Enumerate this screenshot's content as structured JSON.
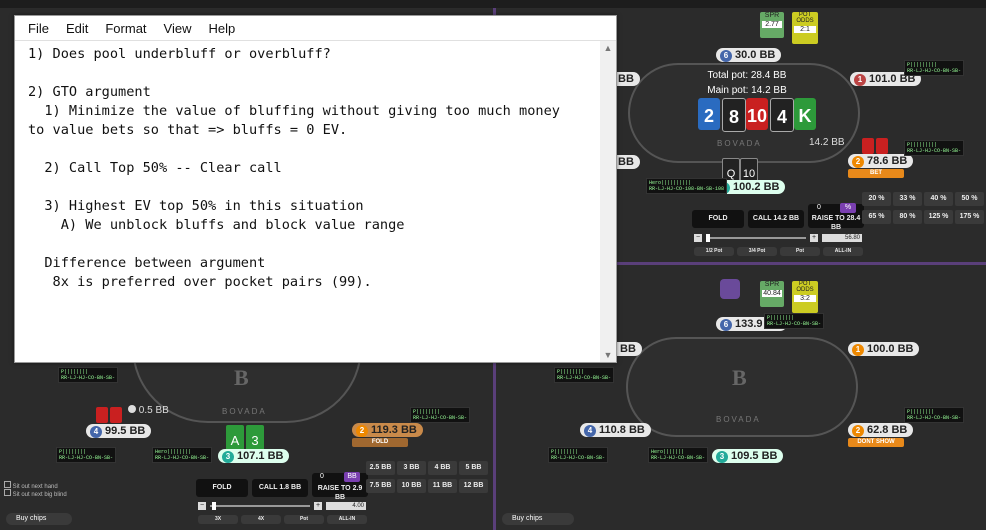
{
  "notepad": {
    "menu": [
      "File",
      "Edit",
      "Format",
      "View",
      "Help"
    ],
    "lines": [
      "1) Does pool underbluff or overbluff?",
      "",
      "2) GTO argument",
      "  1) Minimize the value of bluffing without giving too much money",
      "to value bets so that => bluffs = 0 EV.",
      "",
      "  2) Call Top 50% -- Clear call",
      "",
      "  3) Highest EV top 50% in this situation",
      "    A) We unblock bluffs and block value range",
      "",
      "  Difference between argument",
      "   8x is preferred over pocket pairs (99)."
    ],
    "scroll_up": "▲",
    "scroll_down": "▼"
  },
  "table_top_right": {
    "spr_label": "SPR",
    "spr_value": "2.77",
    "pot_odds_label": "POT ODDS",
    "pot_odds_value": "2:1",
    "total_pot": "Total pot: 28.4 BB",
    "main_pot": "Main pot: 14.2 BB",
    "board": [
      {
        "rank": "2",
        "text": "2",
        "color": "#2a6bc0"
      },
      {
        "rank": "8",
        "text": "8",
        "color": "#222222"
      },
      {
        "rank": "10",
        "text": "10",
        "color": "#c92020"
      },
      {
        "rank": "4",
        "text": "4",
        "color": "#222222"
      },
      {
        "rank": "K",
        "text": "K",
        "color": "#2d9a3a"
      }
    ],
    "brand": "BOVADA",
    "seats": {
      "top": "30.0 BB",
      "left": "BB",
      "right": "101.0 BB",
      "villain": "78.6 BB",
      "villain_action": "BET",
      "villain_bet": "14.2 BB",
      "hero": "100.2 BB",
      "hero_cards": [
        "Q",
        "10"
      ],
      "left2": "BB"
    },
    "actions": {
      "fold": "FOLD",
      "call": "CALL 14.2 BB",
      "raise": "RAISE TO 28.4 BB",
      "raise_amount": "0",
      "pct": "%"
    },
    "bet_sizes_row1": [
      "20 %",
      "33 %",
      "40 %",
      "50 %"
    ],
    "bet_sizes_row2": [
      "65 %",
      "80 %",
      "125 %",
      "175 %"
    ],
    "slider_value": "56.80",
    "presets": [
      "1/2 Pot",
      "3/4 Pot",
      "Pot",
      "ALL-IN"
    ]
  },
  "table_bottom_right": {
    "spr_label": "SPR",
    "spr_value": "40.84",
    "pot_odds_label": "POT ODDS",
    "pot_odds_value": "3:2",
    "brand": "BOVADA",
    "seats": {
      "top": "133.9 BB",
      "left": "BB",
      "right": "100.0 BB",
      "left2": "110.8 BB",
      "villain": "62.8 BB",
      "villain_action": "DONT SHOW",
      "hero": "109.5 BB"
    },
    "buy_chips": "Buy chips"
  },
  "table_bottom_left": {
    "brand": "BOVADA",
    "seats": {
      "left": "99.5 BB",
      "left_bet": "0.5 BB",
      "hero": "107.1 BB",
      "hero_cards": [
        "A",
        "3"
      ],
      "villain": "119.3 BB",
      "villain_action": "FOLD"
    },
    "actions": {
      "fold": "FOLD",
      "call": "CALL 1.8 BB",
      "raise": "RAISE TO 2.9 BB",
      "raise_amount": "0",
      "bb": "BB"
    },
    "bet_sizes_row1": [
      "2.5 BB",
      "3 BB",
      "4 BB",
      "5 BB"
    ],
    "bet_sizes_row2": [
      "7.5 BB",
      "10 BB",
      "11 BB",
      "12 BB"
    ],
    "slider_value": "4.00",
    "presets": [
      "3X",
      "4X",
      "Pot",
      "ALL-IN"
    ],
    "checkbox1": "Sit out next hand",
    "checkbox2": "Sit out next big blind",
    "buy_chips": "Buy chips"
  },
  "left_small": {
    "top_bb": "$ B"
  },
  "colors": {
    "divider": "#5a3f7a",
    "action": "#e8891a",
    "spr": "#6a6",
    "pot_odds": "#cc2"
  }
}
